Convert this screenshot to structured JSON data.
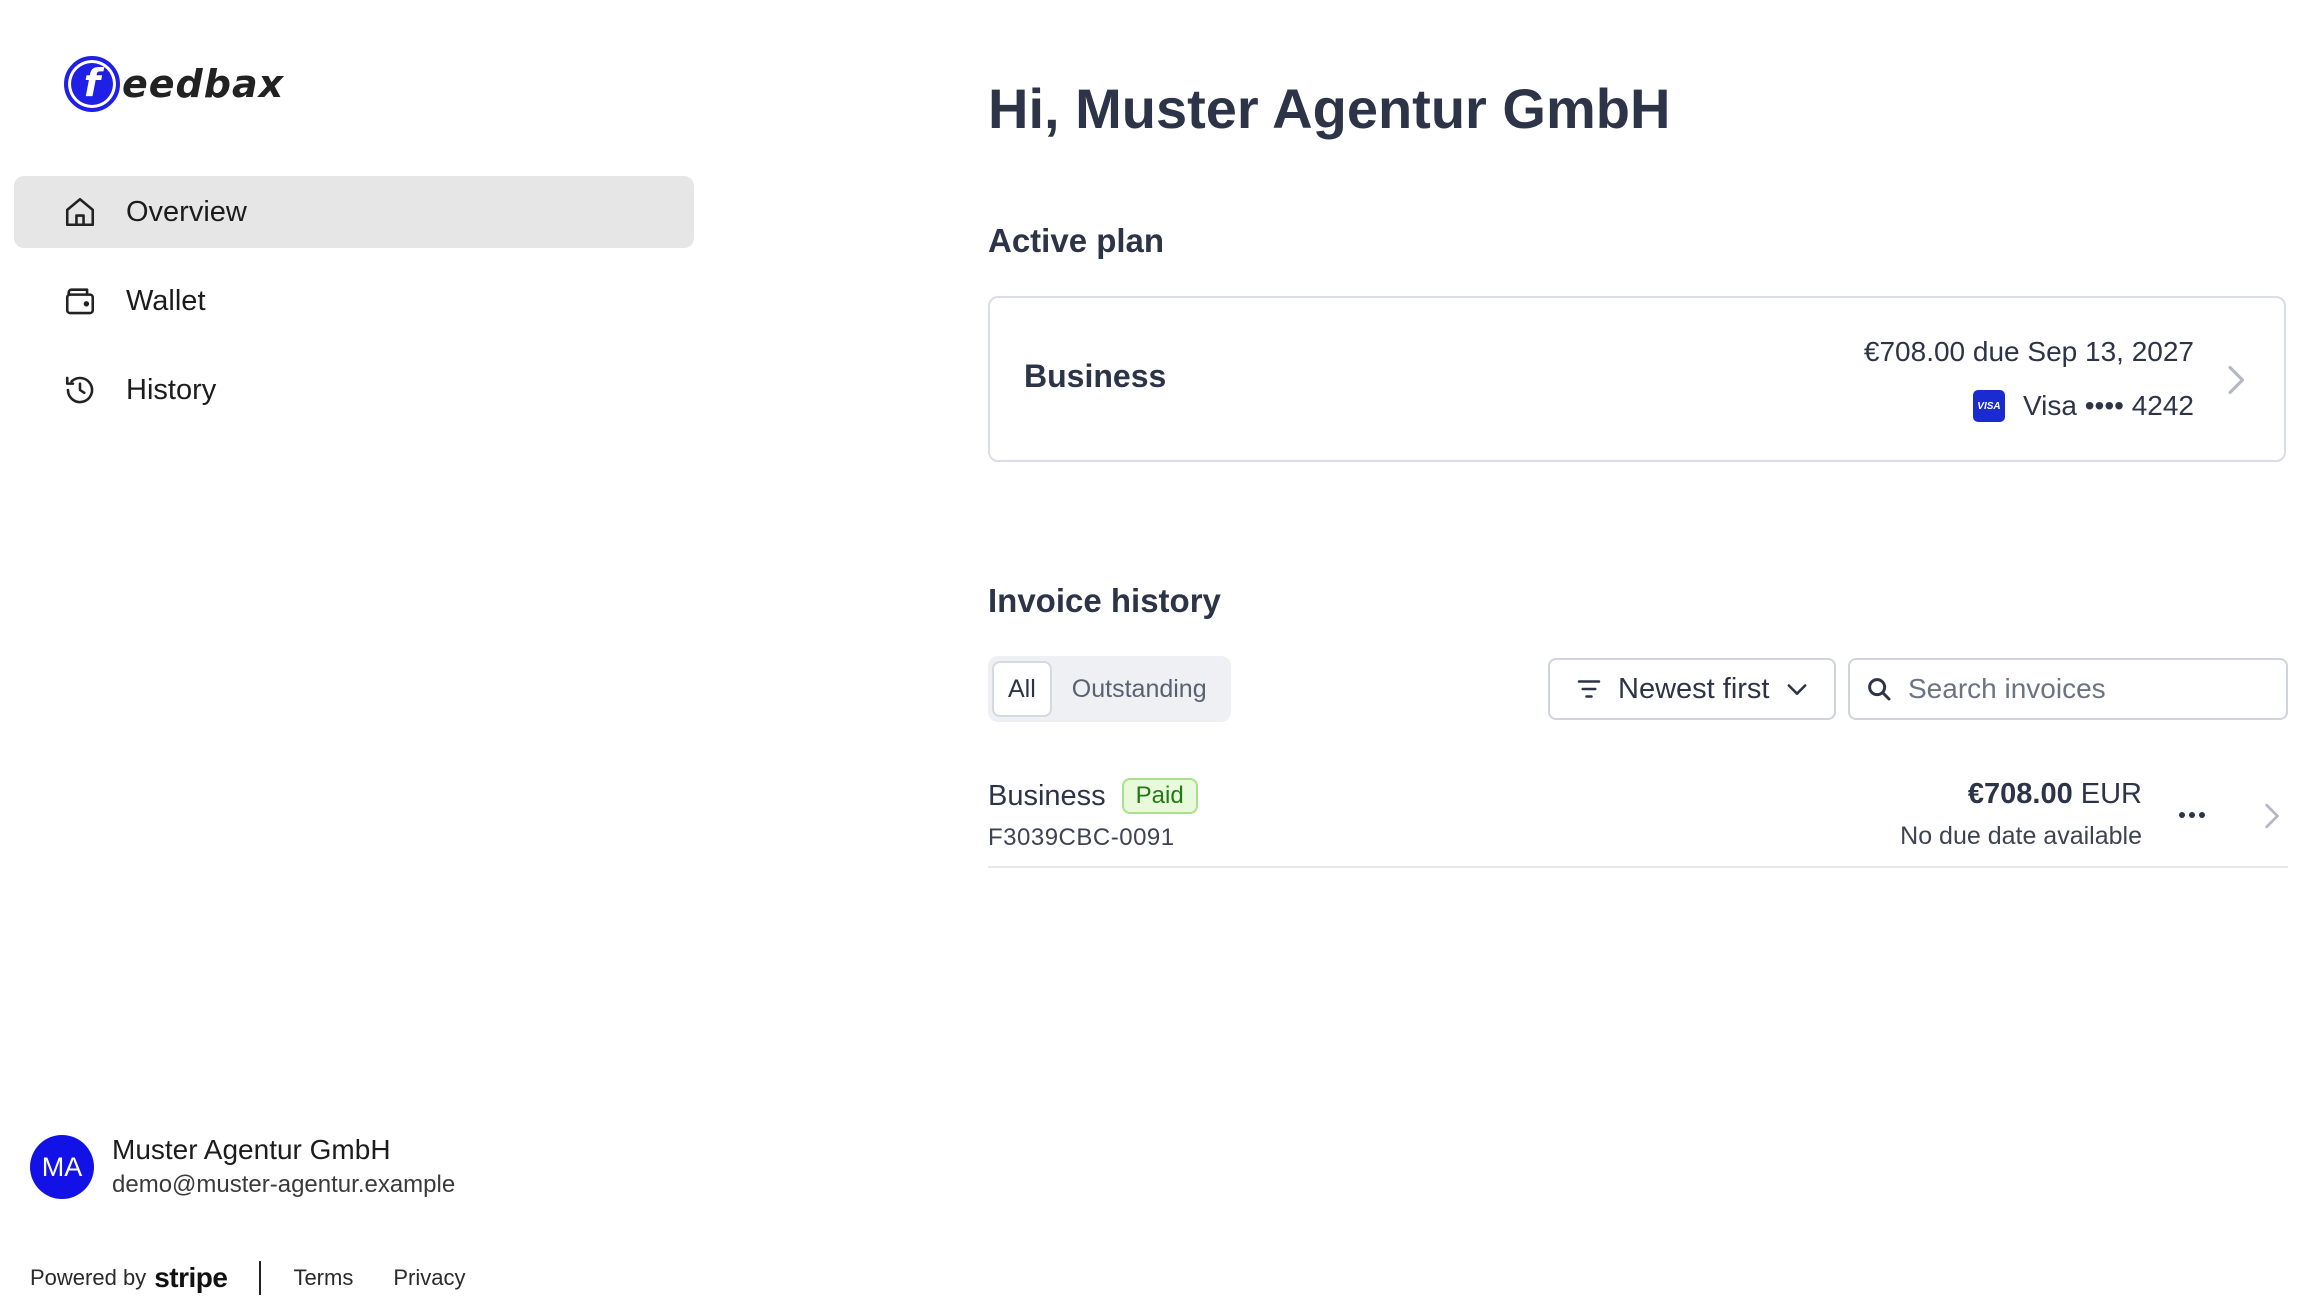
{
  "brand": {
    "logo_letter": "f",
    "logo_text": "eedbax"
  },
  "sidebar": {
    "items": [
      {
        "label": "Overview",
        "icon": "home-icon",
        "active": true
      },
      {
        "label": "Wallet",
        "icon": "wallet-icon",
        "active": false
      },
      {
        "label": "History",
        "icon": "history-icon",
        "active": false
      }
    ]
  },
  "account": {
    "initials": "MA",
    "name": "Muster Agentur GmbH",
    "email": "demo@muster-agentur.example"
  },
  "footer": {
    "powered_by": "Powered by",
    "stripe": "stripe",
    "terms": "Terms",
    "privacy": "Privacy"
  },
  "main": {
    "greeting": "Hi, Muster Agentur GmbH",
    "active_plan": {
      "title": "Active plan",
      "plan_name": "Business",
      "due_text": "€708.00 due Sep 13, 2027",
      "card_brand_badge": "VISA",
      "payment_text": "Visa •••• 4242"
    },
    "invoice_history": {
      "title": "Invoice history",
      "tabs": [
        {
          "label": "All",
          "active": true
        },
        {
          "label": "Outstanding",
          "active": false
        }
      ],
      "sort_label": "Newest first",
      "search_placeholder": "Search invoices",
      "invoices": [
        {
          "name": "Business",
          "status": "Paid",
          "number": "F3039CBC-0091",
          "amount": "€708.00",
          "currency": "EUR",
          "due": "No due date available"
        }
      ]
    }
  },
  "colors": {
    "accent": "#1f1fe6",
    "text": "#2d3447",
    "active_nav_bg": "#e6e6e6",
    "paid_bg": "#e9f9dc",
    "paid_text": "#217a12"
  }
}
